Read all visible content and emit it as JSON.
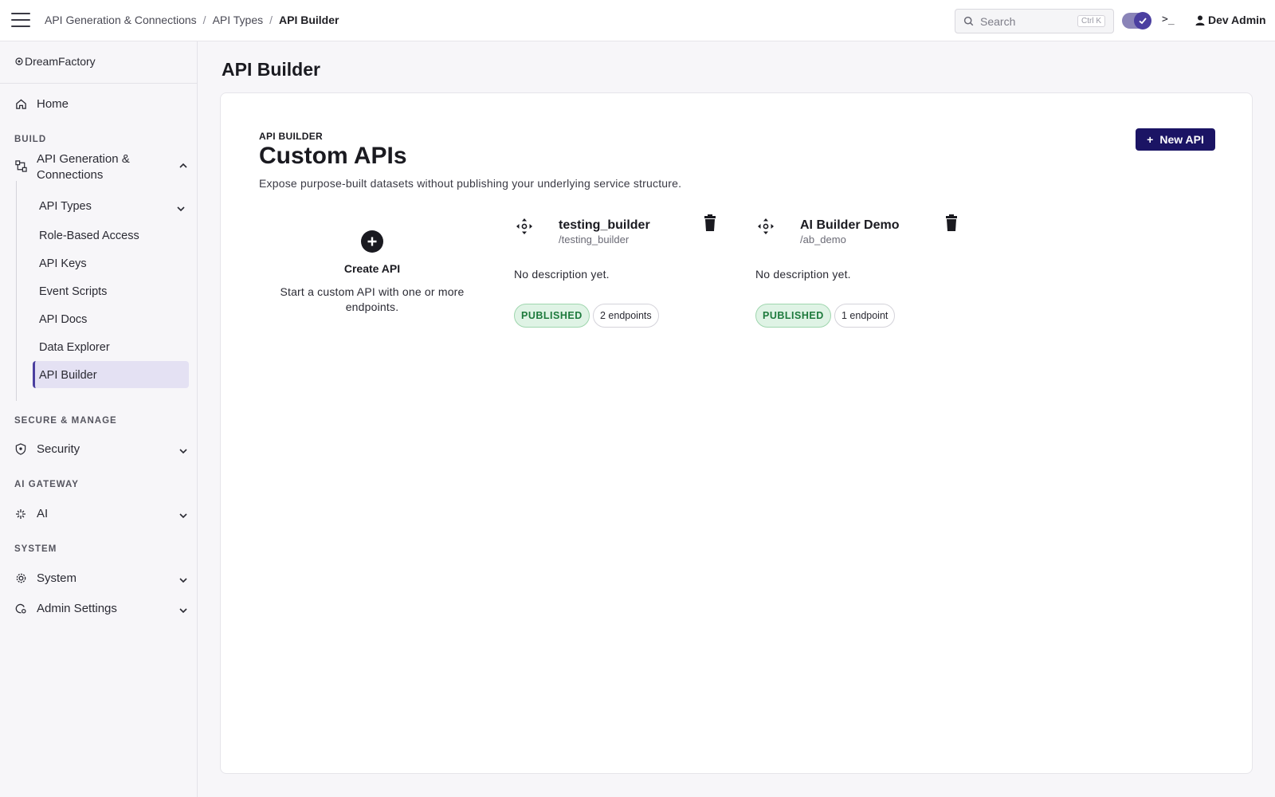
{
  "topbar": {
    "breadcrumb": [
      "API Generation & Connections",
      "API Types",
      "API Builder"
    ],
    "search_placeholder": "Search",
    "search_shortcut": "Ctrl K",
    "terminal_label": ">_",
    "user_name": "Dev Admin"
  },
  "sidebar": {
    "logo": "DreamFactory",
    "home": "Home",
    "sections": {
      "build": "BUILD",
      "secure": "SECURE & MANAGE",
      "ai_gateway": "AI GATEWAY",
      "system": "SYSTEM"
    },
    "api_gen_label_1": "API Generation &",
    "api_gen_label_2": "Connections",
    "sub_items": [
      "API Types",
      "Role-Based Access",
      "API Keys",
      "Event Scripts",
      "API Docs",
      "Data Explorer",
      "API Builder"
    ],
    "security": "Security",
    "ai": "AI",
    "system": "System",
    "admin_settings": "Admin Settings"
  },
  "main": {
    "page_title": "API Builder",
    "eyebrow": "API BUILDER",
    "heading": "Custom APIs",
    "subtext": "Expose purpose-built datasets without publishing your underlying service structure.",
    "new_api_label": "New API",
    "create_title": "Create API",
    "create_desc": "Start a custom API with one or more endpoints.",
    "apis": [
      {
        "name": "testing_builder",
        "path": "/testing_builder",
        "description": "No description yet.",
        "status": "PUBLISHED",
        "endpoints": "2 endpoints"
      },
      {
        "name": "AI Builder Demo",
        "path": "/ab_demo",
        "description": "No description yet.",
        "status": "PUBLISHED",
        "endpoints": "1 endpoint"
      }
    ]
  },
  "colors": {
    "accent": "#1b1464",
    "active_bg": "#e4e1f3",
    "published_bg": "#dff3e5",
    "published_text": "#1d7a3c"
  }
}
